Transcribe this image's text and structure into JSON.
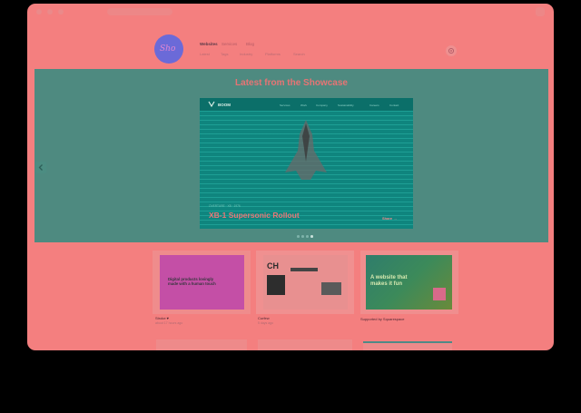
{
  "browser": {
    "chrome": "window"
  },
  "site": {
    "logo_text": "Sho"
  },
  "nav": {
    "items": [
      {
        "label": "Websites"
      },
      {
        "label": "Services"
      },
      {
        "label": "Blog"
      }
    ],
    "sub_items": [
      {
        "label": "Latest"
      },
      {
        "label": "Tags"
      },
      {
        "label": "Industry"
      },
      {
        "label": "Platforms"
      },
      {
        "label": "Search"
      }
    ]
  },
  "showcase": {
    "title": "Latest from the Showcase",
    "slide": {
      "brand": "BOOM",
      "menu": [
        "Services",
        "Work",
        "Company",
        "Sustainability",
        "Careers",
        "Contact"
      ],
      "tag": "OVERTURE · XB · 1976",
      "headline": "XB-1 Supersonic Rollout",
      "cta": "Share →"
    }
  },
  "cards": [
    {
      "thumb_text": "Digital products lovingly made with a human touch",
      "label": "Stroke ♥",
      "sub": "about 17 hours ago"
    },
    {
      "thumb_text": "CH",
      "label": "Curfew",
      "sub": "5 days ago"
    },
    {
      "thumb_text": "A website that makes it fun",
      "label": "Supported by Squarespace",
      "sub": ""
    }
  ],
  "colors": {
    "background": "#f47f7f",
    "showcase_bg": "#4e8a80",
    "slide_bg": "#0e7f78",
    "headline": "#e87878",
    "logo": "#6b6ad8"
  }
}
